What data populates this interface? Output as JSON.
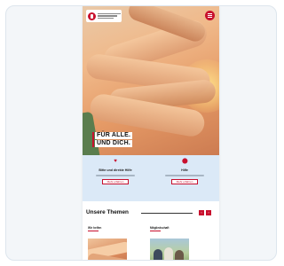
{
  "hero": {
    "title_line1": "FÜR ALLE.",
    "title_line2": "UND DICH."
  },
  "info": {
    "left": {
      "icon": "heart-icon",
      "title": "Bitte und direkte Hilfe",
      "button": "Mehr erfahren"
    },
    "right": {
      "icon": "location-pin-icon",
      "title": "Hilfe",
      "button": "Mehr erfahren"
    }
  },
  "themes": {
    "heading": "Unsere Themen",
    "prev_label": "‹",
    "next_label": "›",
    "tiles": [
      {
        "label": "Wir helfen"
      },
      {
        "label": "Mitgliedschaft"
      }
    ]
  },
  "colors": {
    "brand_red": "#c8102e",
    "info_band": "#dbe9f7"
  }
}
